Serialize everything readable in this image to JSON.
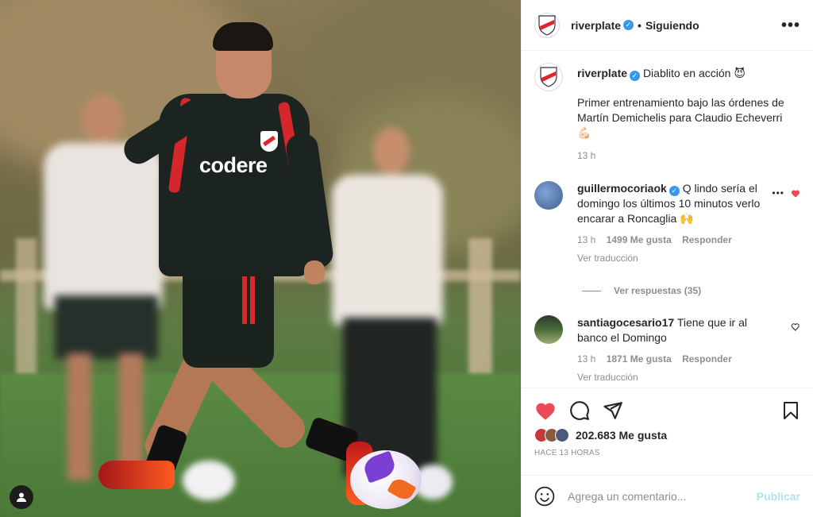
{
  "post": {
    "author": "riverplate",
    "follow_state": "Siguiendo",
    "dot": "•",
    "more": "•••",
    "caption_title": "Diablito en acción",
    "caption_emoji": "😈",
    "caption_body": "Primer entrenamiento bajo las órdenes de Martín Demichelis para Claudio Echeverri",
    "caption_tail_emoji": "💪🏻",
    "caption_time": "13 h",
    "jersey_sponsor": "codere"
  },
  "comments": [
    {
      "user": "guillermocoriaok",
      "verified": true,
      "text": "Q lindo sería el domingo los últimos 10 minutos verlo encarar a Roncaglia",
      "emoji": "🙌",
      "time": "13 h",
      "likes": "1499 Me gusta",
      "reply": "Responder",
      "translate": "Ver traducción",
      "liked": true,
      "view_replies": "Ver respuestas (35)"
    },
    {
      "user": "santiagocesario17",
      "verified": false,
      "text": "Tiene que ir al banco el Domingo",
      "time": "13 h",
      "likes": "1871 Me gusta",
      "reply": "Responder",
      "translate": "Ver traducción",
      "liked": false
    }
  ],
  "stats": {
    "likes": "202.683 Me gusta",
    "posted": "HACE 13 HORAS"
  },
  "composer": {
    "placeholder": "Agrega un comentario...",
    "publish": "Publicar"
  },
  "colors": {
    "like_red": "#ed4956",
    "verified_blue": "#3897f0",
    "river_red": "#e1232e"
  },
  "icons": [
    "heart-icon",
    "comment-icon",
    "share-icon",
    "bookmark-icon",
    "emoji-icon",
    "user-tag-icon",
    "more-icon"
  ]
}
